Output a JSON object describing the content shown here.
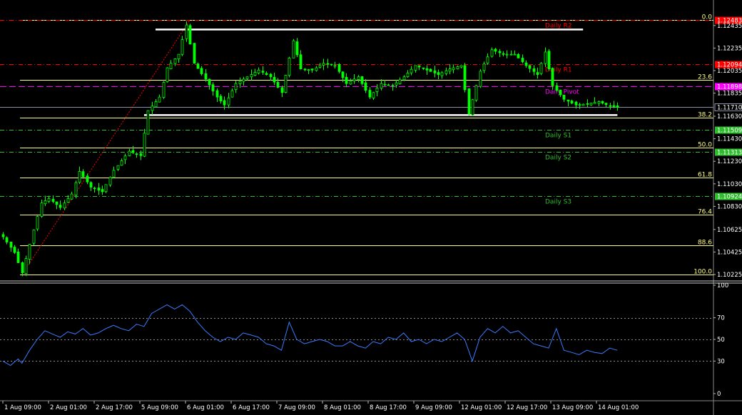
{
  "colors": {
    "background": "#000000",
    "candle_up": "#00ff00",
    "candle_down": "#00ff00",
    "fib": "#ffff7f",
    "fib_label": "#ffff7f",
    "pivot_resistance": "#ff0000",
    "pivot": "#ff00ff",
    "pivot_support": "#2dbd2d",
    "rsi_line": "#3a7bff",
    "trend_line": "#ff0000",
    "channel_line": "#ffffff",
    "axis_text": "#ffffff",
    "grid_dotted": "#bbbbbb",
    "current_price_line": "#8c8fa8"
  },
  "chart_data": [
    {
      "type": "candlestick",
      "symbol_period": "",
      "ylim": [
        1.10225,
        1.12535
      ],
      "price_ticks": [
        "1.12435",
        "1.12235",
        "1.12035",
        "1.11835",
        "1.11630",
        "1.11430",
        "1.11230",
        "1.11030",
        "1.10830",
        "1.10625",
        "1.10425",
        "1.10225"
      ],
      "x_ticks": [
        "1 Aug 09:00",
        "2 Aug 01:00",
        "2 Aug 17:00",
        "5 Aug 09:00",
        "6 Aug 01:00",
        "6 Aug 17:00",
        "7 Aug 09:00",
        "8 Aug 01:00",
        "8 Aug 17:00",
        "9 Aug 09:00",
        "12 Aug 01:00",
        "12 Aug 17:00",
        "13 Aug 09:00",
        "14 Aug 01:00"
      ],
      "current_price": "1.11710",
      "fibonacci": {
        "high": 1.12483,
        "low": 1.10225,
        "levels": [
          {
            "label": "0.0",
            "price": 1.12483
          },
          {
            "label": "23.6",
            "price": 1.1195
          },
          {
            "label": "38.2",
            "price": 1.1162
          },
          {
            "label": "50.0",
            "price": 1.11354
          },
          {
            "label": "61.8",
            "price": 1.11088
          },
          {
            "label": "76.4",
            "price": 1.10758
          },
          {
            "label": "88.6",
            "price": 1.10483
          },
          {
            "label": "100.0",
            "price": 1.10225
          }
        ]
      },
      "pivots": [
        {
          "name": "Daily R2",
          "price": 1.12483,
          "kind": "resistance",
          "badge": "1.12483"
        },
        {
          "name": "Daily R1",
          "price": 1.12094,
          "kind": "resistance",
          "badge": "1.12094"
        },
        {
          "name": "Daily Pivot",
          "price": 1.11898,
          "kind": "pivot",
          "badge": "1.11898"
        },
        {
          "name": "Daily S1",
          "price": 1.11509,
          "kind": "support",
          "badge": "1.11509"
        },
        {
          "name": "Daily S2",
          "price": 1.11313,
          "kind": "support",
          "badge": "1.11313"
        },
        {
          "name": "Daily S3",
          "price": 1.10924,
          "kind": "support",
          "badge": "1.10924"
        }
      ],
      "channel_lines": [
        {
          "from_bar": 40,
          "to_bar": 152,
          "price": 1.124
        },
        {
          "from_bar": 37,
          "to_bar": 161,
          "price": 1.1164
        }
      ],
      "trend_line": {
        "from_bar": 5,
        "from_price": 1.10225,
        "to_bar": 49,
        "to_price": 1.12483
      },
      "bars": 162,
      "closes_keypoints": [
        [
          0,
          1.1056
        ],
        [
          3,
          1.1042
        ],
        [
          5,
          1.1024
        ],
        [
          8,
          1.1062
        ],
        [
          10,
          1.1086
        ],
        [
          12,
          1.109
        ],
        [
          15,
          1.1082
        ],
        [
          18,
          1.1094
        ],
        [
          20,
          1.1114
        ],
        [
          23,
          1.11
        ],
        [
          26,
          1.1096
        ],
        [
          29,
          1.1115
        ],
        [
          33,
          1.1132
        ],
        [
          36,
          1.1128
        ],
        [
          38,
          1.1168
        ],
        [
          41,
          1.118
        ],
        [
          43,
          1.1206
        ],
        [
          46,
          1.1218
        ],
        [
          48,
          1.1244
        ],
        [
          50,
          1.121
        ],
        [
          53,
          1.1196
        ],
        [
          56,
          1.118
        ],
        [
          58,
          1.1173
        ],
        [
          61,
          1.1192
        ],
        [
          64,
          1.1198
        ],
        [
          67,
          1.1204
        ],
        [
          70,
          1.1198
        ],
        [
          73,
          1.1184
        ],
        [
          76,
          1.123
        ],
        [
          78,
          1.1205
        ],
        [
          81,
          1.1204
        ],
        [
          84,
          1.121
        ],
        [
          87,
          1.1208
        ],
        [
          90,
          1.1192
        ],
        [
          93,
          1.1198
        ],
        [
          96,
          1.118
        ],
        [
          99,
          1.1192
        ],
        [
          102,
          1.119
        ],
        [
          105,
          1.1198
        ],
        [
          108,
          1.1208
        ],
        [
          111,
          1.1204
        ],
        [
          114,
          1.12
        ],
        [
          117,
          1.1205
        ],
        [
          120,
          1.1208
        ],
        [
          122,
          1.1165
        ],
        [
          125,
          1.1203
        ],
        [
          128,
          1.1222
        ],
        [
          131,
          1.1218
        ],
        [
          134,
          1.1218
        ],
        [
          137,
          1.1208
        ],
        [
          140,
          1.12
        ],
        [
          142,
          1.122
        ],
        [
          144,
          1.119
        ],
        [
          147,
          1.1178
        ],
        [
          150,
          1.1173
        ],
        [
          153,
          1.1174
        ],
        [
          156,
          1.1176
        ],
        [
          159,
          1.1172
        ],
        [
          161,
          1.1171
        ]
      ]
    },
    {
      "type": "line",
      "indicator": "RSI",
      "ylim": [
        0,
        100
      ],
      "y_ticks": [
        "100",
        "70",
        "50",
        "30",
        "0"
      ],
      "levels": [
        70,
        50,
        30
      ],
      "values_keypoints": [
        [
          0,
          30
        ],
        [
          2,
          26
        ],
        [
          4,
          32
        ],
        [
          5,
          28
        ],
        [
          7,
          40
        ],
        [
          9,
          50
        ],
        [
          11,
          58
        ],
        [
          13,
          55
        ],
        [
          15,
          52
        ],
        [
          17,
          57
        ],
        [
          19,
          55
        ],
        [
          21,
          60
        ],
        [
          23,
          54
        ],
        [
          25,
          56
        ],
        [
          27,
          60
        ],
        [
          29,
          63
        ],
        [
          31,
          60
        ],
        [
          33,
          58
        ],
        [
          35,
          64
        ],
        [
          37,
          62
        ],
        [
          39,
          74
        ],
        [
          41,
          78
        ],
        [
          43,
          82
        ],
        [
          45,
          78
        ],
        [
          47,
          82
        ],
        [
          49,
          76
        ],
        [
          51,
          66
        ],
        [
          53,
          58
        ],
        [
          55,
          52
        ],
        [
          57,
          48
        ],
        [
          59,
          52
        ],
        [
          61,
          50
        ],
        [
          63,
          56
        ],
        [
          65,
          54
        ],
        [
          67,
          52
        ],
        [
          69,
          46
        ],
        [
          71,
          44
        ],
        [
          73,
          40
        ],
        [
          75,
          66
        ],
        [
          77,
          50
        ],
        [
          79,
          46
        ],
        [
          81,
          48
        ],
        [
          83,
          50
        ],
        [
          85,
          48
        ],
        [
          87,
          44
        ],
        [
          89,
          44
        ],
        [
          91,
          48
        ],
        [
          93,
          44
        ],
        [
          95,
          42
        ],
        [
          97,
          48
        ],
        [
          99,
          46
        ],
        [
          101,
          52
        ],
        [
          103,
          50
        ],
        [
          105,
          56
        ],
        [
          107,
          48
        ],
        [
          109,
          50
        ],
        [
          111,
          46
        ],
        [
          113,
          50
        ],
        [
          115,
          48
        ],
        [
          117,
          52
        ],
        [
          119,
          56
        ],
        [
          121,
          50
        ],
        [
          123,
          30
        ],
        [
          125,
          52
        ],
        [
          127,
          60
        ],
        [
          129,
          56
        ],
        [
          131,
          62
        ],
        [
          133,
          56
        ],
        [
          135,
          58
        ],
        [
          137,
          52
        ],
        [
          139,
          46
        ],
        [
          141,
          44
        ],
        [
          143,
          42
        ],
        [
          145,
          60
        ],
        [
          147,
          40
        ],
        [
          149,
          38
        ],
        [
          151,
          36
        ],
        [
          153,
          40
        ],
        [
          155,
          38
        ],
        [
          157,
          37
        ],
        [
          159,
          42
        ],
        [
          161,
          40
        ]
      ]
    }
  ]
}
